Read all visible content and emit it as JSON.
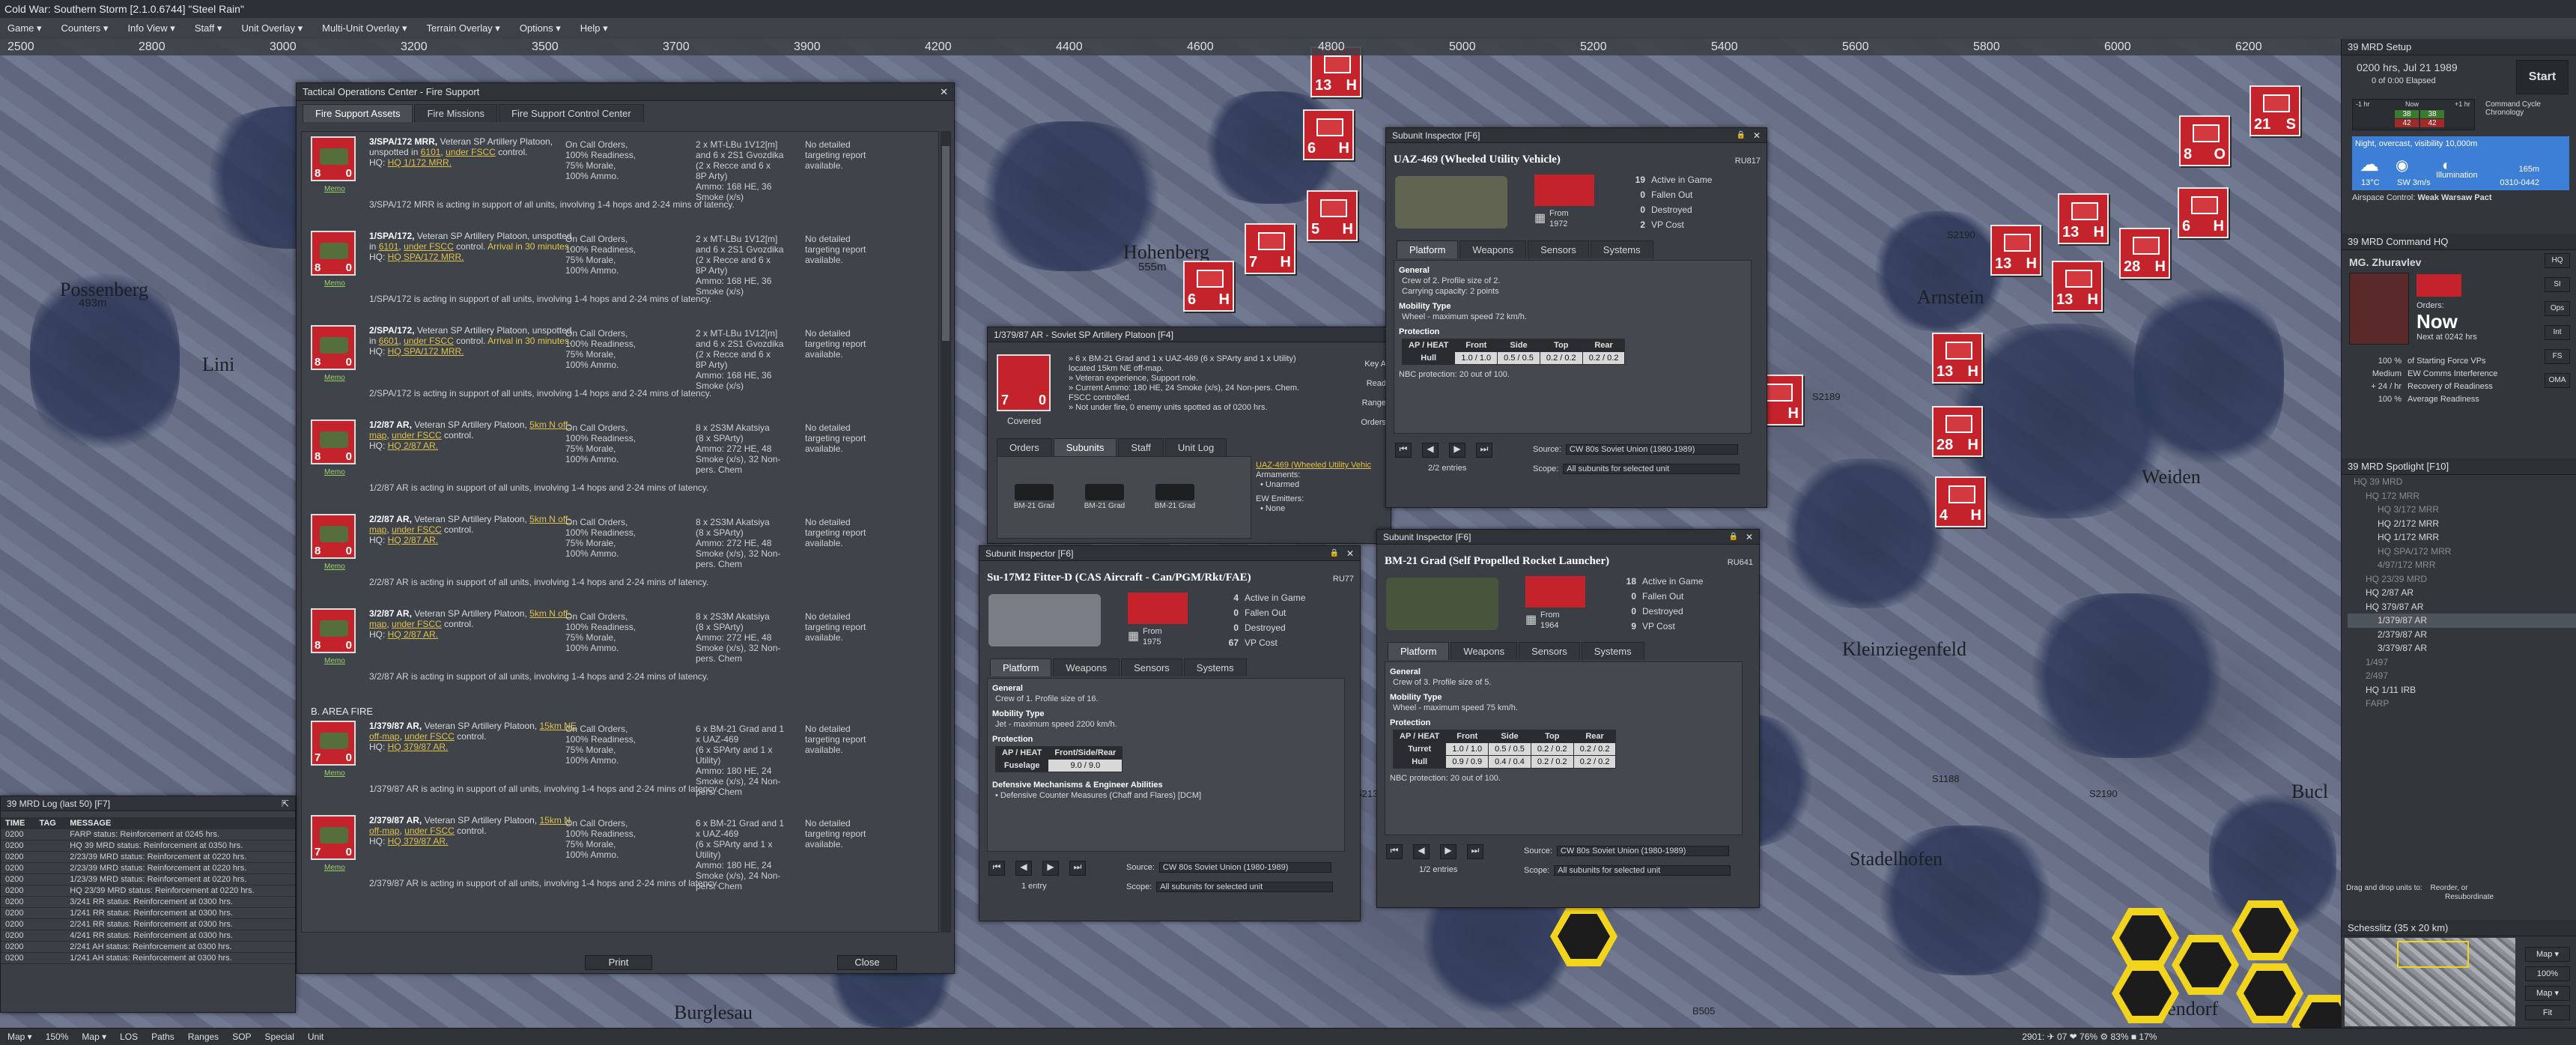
{
  "app": {
    "title": "Cold War: Southern Storm  [2.1.0.6744]  \"Steel Rain\""
  },
  "menu": [
    "Game ▾",
    "Counters ▾",
    "Info View ▾",
    "Staff ▾",
    "Unit Overlay ▾",
    "Multi-Unit Overlay ▾",
    "Terrain Overlay ▾",
    "Options ▾",
    "Help ▾"
  ],
  "ruler": [
    "2500",
    "2800",
    "3000",
    "3200",
    "3500",
    "3700",
    "3900",
    "4200",
    "4400",
    "4600",
    "4800",
    "5000",
    "5200",
    "5400",
    "5600",
    "5800",
    "6000",
    "6200"
  ],
  "map": {
    "towns": [
      "Possenberg",
      "Hohenberg",
      "Arnstein",
      "Weiden",
      "Kleinziegenfeld",
      "Stadelhofen",
      "Burglesau",
      "Wotzendorf",
      "Bucl",
      "Lini"
    ],
    "elevations": [
      "493m",
      "555m",
      "606m",
      "520m"
    ],
    "roads": [
      "S2190",
      "S2189",
      "S1188",
      "S2190",
      "B505",
      "S2136"
    ]
  },
  "fire_support": {
    "title": "Tactical Operations Center - Fire Support",
    "tabs": [
      "Fire Support Assets",
      "Fire Missions",
      "Fire Support Control Center"
    ],
    "section_b": "B. AREA FIRE",
    "print_label": "Print",
    "close_label": "Close",
    "assets": [
      {
        "name": "3/SPA/172 MRR,",
        "desc": "Veteran SP Artillery Platoon, unspotted in ",
        "hex": "6101",
        "fscc": "under FSCC",
        "extra": " control.",
        "arrival": "",
        "hq_label": "HQ: ",
        "hq": "HQ 1/172 MRR.",
        "orders": "On Call Orders,\n100% Readiness,\n75% Morale,\n100% Ammo.",
        "ammo": "2 x MT-LBu 1V12[m]\nand 6 x 2S1 Gvozdika\n(2 x Recce and 6 x\n8P Arty)\nAmmo: 168 HE, 36\nSmoke (x/s)",
        "report": "No detailed\ntargeting report\navailable.",
        "summary": "3/SPA/172 MRR is acting in support of all units, involving 1-4 hops and 2-24 mins of latency.",
        "v": "8",
        "d": "0",
        "memo": "Memo"
      },
      {
        "name": "1/SPA/172,",
        "desc": "Veteran SP Artillery Platoon, unspotted in ",
        "hex": "6101",
        "fscc": "under FSCC",
        "extra": " control. ",
        "arrival": "Arrival in 30 minutes.",
        "hq_label": "HQ: ",
        "hq": "HQ SPA/172 MRR.",
        "orders": "On Call Orders,\n100% Readiness,\n75% Morale,\n100% Ammo.",
        "ammo": "2 x MT-LBu 1V12[m]\nand 6 x 2S1 Gvozdika\n(2 x Recce and 6 x\n8P Arty)\nAmmo: 168 HE, 36\nSmoke (x/s)",
        "report": "No detailed\ntargeting report\navailable.",
        "summary": "1/SPA/172 is acting in support of all units, involving 1-4 hops and 2-24 mins of latency.",
        "v": "8",
        "d": "0",
        "memo": "Memo"
      },
      {
        "name": "2/SPA/172,",
        "desc": "Veteran SP Artillery Platoon, unspotted in ",
        "hex": "6601",
        "fscc": "under FSCC",
        "extra": " control. ",
        "arrival": "Arrival in 30 minutes.",
        "hq_label": "HQ: ",
        "hq": "HQ SPA/172 MRR.",
        "orders": "On Call Orders,\n100% Readiness,\n75% Morale,\n100% Ammo.",
        "ammo": "2 x MT-LBu 1V12[m]\nand 6 x 2S1 Gvozdika\n(2 x Recce and 6 x\n8P Arty)\nAmmo: 168 HE, 36\nSmoke (x/s)",
        "report": "No detailed\ntargeting report\navailable.",
        "summary": "2/SPA/172 is acting in support of all units, involving 1-4 hops and 2-24 mins of latency.",
        "v": "8",
        "d": "0",
        "memo": "Memo"
      },
      {
        "name": "1/2/87 AR,",
        "desc": "Veteran SP Artillery Platoon, ",
        "hex": "5km N off-map",
        "fscc": "under FSCC",
        "extra": " control.",
        "arrival": "",
        "hq_label": "HQ: ",
        "hq": "HQ 2/87 AR.",
        "orders": "On Call Orders,\n100% Readiness,\n75% Morale,\n100% Ammo.",
        "ammo": "8 x 2S3M Akatsiya\n(8 x SPArty)\nAmmo: 272 HE, 48\nSmoke (x/s), 32 Non-\npers. Chem",
        "report": "No detailed\ntargeting report\navailable.",
        "summary": "1/2/87 AR is acting in support of all units, involving 1-4 hops and 2-24 mins of latency.",
        "v": "8",
        "d": "0",
        "memo": "Memo"
      },
      {
        "name": "2/2/87 AR,",
        "desc": "Veteran SP Artillery Platoon, ",
        "hex": "5km N off-map",
        "fscc": "under FSCC",
        "extra": " control.",
        "arrival": "",
        "hq_label": "HQ: ",
        "hq": "HQ 2/87 AR.",
        "orders": "On Call Orders,\n100% Readiness,\n75% Morale,\n100% Ammo.",
        "ammo": "8 x 2S3M Akatsiya\n(8 x SPArty)\nAmmo: 272 HE, 48\nSmoke (x/s), 32 Non-\npers. Chem",
        "report": "No detailed\ntargeting report\navailable.",
        "summary": "2/2/87 AR is acting in support of all units, involving 1-4 hops and 2-24 mins of latency.",
        "v": "8",
        "d": "0",
        "memo": "Memo"
      },
      {
        "name": "3/2/87 AR,",
        "desc": "Veteran SP Artillery Platoon, ",
        "hex": "5km N off-map",
        "fscc": "under FSCC",
        "extra": " control.",
        "arrival": "",
        "hq_label": "HQ: ",
        "hq": "HQ 2/87 AR.",
        "orders": "On Call Orders,\n100% Readiness,\n75% Morale,\n100% Ammo.",
        "ammo": "8 x 2S3M Akatsiya\n(8 x SPArty)\nAmmo: 272 HE, 48\nSmoke (x/s), 32 Non-\npers. Chem",
        "report": "No detailed\ntargeting report\navailable.",
        "summary": "3/2/87 AR is acting in support of all units, involving 1-4 hops and 2-24 mins of latency.",
        "v": "8",
        "d": "0",
        "memo": "Memo"
      },
      {
        "name": "1/379/87 AR,",
        "desc": "Veteran SP Artillery Platoon, ",
        "hex": "15km NE off-map",
        "fscc": "under FSCC",
        "extra": " control.",
        "arrival": "",
        "hq_label": "HQ: ",
        "hq": "HQ 379/87 AR.",
        "orders": "On Call Orders,\n100% Readiness,\n75% Morale,\n100% Ammo.",
        "ammo": "6 x BM-21 Grad and 1\nx UAZ-469\n(6 x SPArty and 1 x\nUtility)\nAmmo: 180 HE, 24\nSmoke (x/s), 24 Non-\npers. Chem",
        "report": "No detailed\ntargeting report\navailable.",
        "summary": "1/379/87 AR is acting in support of all units, involving 1-4 hops and 2-24 mins of latency.",
        "v": "7",
        "d": "0",
        "memo": "Memo"
      },
      {
        "name": "2/379/87 AR,",
        "desc": "Veteran SP Artillery Platoon, ",
        "hex": "15km N off-map",
        "fscc": "under FSCC",
        "extra": " control.",
        "arrival": "",
        "hq_label": "HQ: ",
        "hq": "HQ 379/87 AR.",
        "orders": "On Call Orders,\n100% Readiness,\n75% Morale,\n100% Ammo.",
        "ammo": "6 x BM-21 Grad and 1\nx UAZ-469\n(6 x SPArty and 1 x\nUtility)\nAmmo: 180 HE, 24\nSmoke (x/s), 24 Non-\npers. Chem",
        "report": "No detailed\ntargeting report\navailable.",
        "summary": "2/379/87 AR is acting in support of all units, involving 1-4 hops and 2-24 mins of latency.",
        "v": "7",
        "d": "0",
        "memo": "Memo"
      }
    ]
  },
  "log": {
    "title": "39 MRD Log (last 50)  [F7]",
    "headers": [
      "TIME",
      "TAG",
      "MESSAGE"
    ],
    "rows": [
      [
        "0200",
        "",
        "FARP status: Reinforcement at 0245 hrs."
      ],
      [
        "0200",
        "",
        "HQ 39 MRD status: Reinforcement at 0350 hrs."
      ],
      [
        "0200",
        "",
        "2/23/39 MRD status: Reinforcement at 0220 hrs."
      ],
      [
        "0200",
        "",
        "2/23/39 MRD status: Reinforcement at 0220 hrs."
      ],
      [
        "0200",
        "",
        "1/23/39 MRD status: Reinforcement at 0220 hrs."
      ],
      [
        "0200",
        "",
        "HQ 23/39 MRD status: Reinforcement at 0220 hrs."
      ],
      [
        "0200",
        "",
        "3/241 RR status: Reinforcement at 0300 hrs."
      ],
      [
        "0200",
        "",
        "1/241 RR status: Reinforcement at 0300 hrs."
      ],
      [
        "0200",
        "",
        "2/241 RR status: Reinforcement at 0300 hrs."
      ],
      [
        "0200",
        "",
        "4/241 RR status: Reinforcement at 0300 hrs."
      ],
      [
        "0200",
        "",
        "2/241 AH status: Reinforcement at 0300 hrs."
      ],
      [
        "0200",
        "",
        "1/241 AH status: Reinforcement at 0300 hrs."
      ]
    ]
  },
  "unit_panel": {
    "title": "1/379/87 AR - Soviet SP Artillery Platoon   [F4]",
    "summary": "» 6 x BM-21 Grad and 1 x UAZ-469 (6 x SPArty and 1 x Utility)\nlocated 15km NE off-map.\n» Veteran experience, Support role.\n» Current Ammo: 180 HE, 24 Smoke (x/s), 24 Non-pers. Chem.\nFSCC controlled.\n» Not under fire, 0 enemy units spotted as of 0200 hrs.",
    "status": "Covered",
    "tabs": [
      "Orders",
      "Subunits",
      "Staff",
      "Unit Log"
    ],
    "subunits": [
      "BM-21 Grad",
      "BM-21 Grad",
      "BM-21 Grad"
    ],
    "side_link": "UAZ-469 (Wheeled Utility Vehic",
    "armaments_label": "Armaments:",
    "armaments": "• Unarmed",
    "ew_label": "EW Emitters:",
    "ew": "• None",
    "right_labels": [
      "Key A",
      "Read",
      "Range",
      "Orders"
    ],
    "v": "7",
    "d": "0"
  },
  "inspector_uaz": {
    "title": "Subunit Inspector   [F6]",
    "name": "UAZ-469 (Wheeled Utility Vehicle)",
    "code": "RU817",
    "from_label": "From",
    "year": "1972",
    "stats": [
      [
        "19",
        "Active in Game"
      ],
      [
        "0",
        "Fallen Out"
      ],
      [
        "0",
        "Destroyed"
      ],
      [
        "2",
        "VP Cost"
      ]
    ],
    "tabs": [
      "Platform",
      "Weapons",
      "Sensors",
      "Systems"
    ],
    "general_h": "General",
    "general": "Crew of 2. Profile size of 2.\nCarrying capacity: 2 points",
    "mobility_h": "Mobility Type",
    "mobility": "Wheel - maximum speed 72 km/h.",
    "protection_h": "Protection",
    "prot_head": [
      "AP / HEAT",
      "Front",
      "Side",
      "Top",
      "Rear"
    ],
    "prot_rows": [
      [
        "Hull",
        "1.0 / 1.0",
        "0.5 / 0.5",
        "0.2 / 0.2",
        "0.2 / 0.2"
      ]
    ],
    "nbc": "NBC protection: 20 out of 100.",
    "entries": "2/2 entries",
    "source_label": "Source:",
    "source": "CW 80s Soviet Union (1980-1989)",
    "scope_label": "Scope:",
    "scope": "All subunits for selected unit"
  },
  "inspector_su17": {
    "title": "Subunit Inspector   [F6]",
    "name": "Su-17M2 Fitter-D (CAS Aircraft - Can/PGM/Rkt/FAE)",
    "code": "RU77",
    "from_label": "From",
    "year": "1975",
    "stats": [
      [
        "4",
        "Active in Game"
      ],
      [
        "0",
        "Fallen Out"
      ],
      [
        "0",
        "Destroyed"
      ],
      [
        "67",
        "VP Cost"
      ]
    ],
    "tabs": [
      "Platform",
      "Weapons",
      "Sensors",
      "Systems"
    ],
    "general_h": "General",
    "general": "Crew of 1. Profile size of 16.",
    "mobility_h": "Mobility Type",
    "mobility": "Jet - maximum speed 2200 km/h.",
    "protection_h": "Protection",
    "prot_head": [
      "AP / HEAT",
      "Front/Side/Rear"
    ],
    "prot_rows": [
      [
        "Fuselage",
        "9.0 / 9.0"
      ]
    ],
    "defensive_h": "Defensive Mechanisms & Engineer Abilities",
    "defensive": "• Defensive Counter Measures (Chaff and Flares) [DCM]",
    "entries": "1 entry",
    "source_label": "Source:",
    "source": "CW 80s Soviet Union (1980-1989)",
    "scope_label": "Scope:",
    "scope": "All subunits for selected unit"
  },
  "inspector_bm21": {
    "title": "Subunit Inspector   [F6]",
    "name": "BM-21 Grad (Self Propelled Rocket Launcher)",
    "code": "RU641",
    "from_label": "From",
    "year": "1964",
    "stats": [
      [
        "18",
        "Active in Game"
      ],
      [
        "0",
        "Fallen Out"
      ],
      [
        "0",
        "Destroyed"
      ],
      [
        "9",
        "VP Cost"
      ]
    ],
    "tabs": [
      "Platform",
      "Weapons",
      "Sensors",
      "Systems"
    ],
    "general_h": "General",
    "general": "Crew of 3. Profile size of 5.",
    "mobility_h": "Mobility Type",
    "mobility": "Wheel - maximum speed 75 km/h.",
    "protection_h": "Protection",
    "prot_head": [
      "AP / HEAT",
      "Front",
      "Side",
      "Top",
      "Rear"
    ],
    "prot_rows": [
      [
        "Turret",
        "1.0 / 1.0",
        "0.5 / 0.5",
        "0.2 / 0.2",
        "0.2 / 0.2"
      ],
      [
        "Hull",
        "0.9 / 0.9",
        "0.4 / 0.4",
        "0.2 / 0.2",
        "0.2 / 0.2"
      ]
    ],
    "nbc": "NBC protection: 20 out of 100.",
    "entries": "1/2 entries",
    "source_label": "Source:",
    "source": "CW 80s Soviet Union (1980-1989)",
    "scope_label": "Scope:",
    "scope": "All subunits for selected unit"
  },
  "setup": {
    "title": "39 MRD Setup",
    "time": "0200 hrs, Jul 21 1989",
    "elapsed": "0 of 0:00 Elapsed",
    "start": "Start",
    "chrono_labels": [
      "-1 hr",
      "Now",
      "+1 hr"
    ],
    "chrono_values": [
      "38",
      "38",
      "42",
      "42"
    ],
    "cycle": "Command Cycle\nChronology",
    "weather": "Night, overcast, visibility 10,000m",
    "temp": "13°C",
    "wind": "SW 3m/s",
    "illumination_label": "Illumination",
    "vis": "165m",
    "moon": "0310-0442",
    "airspace_label": "Airspace Control:",
    "airspace": "Weak Warsaw Pact"
  },
  "command": {
    "title": "39 MRD Command HQ",
    "hq_label": "HQ",
    "commander": "MG. Zhuravlev",
    "orders_label": "Orders:",
    "orders": "Now",
    "next": "Next at 0242 hrs",
    "stats": [
      [
        "100 %",
        "of Starting Force VPs"
      ],
      [
        "Medium",
        "EW Comms Interference"
      ],
      [
        "+ 24 / hr",
        "Recovery of Readiness"
      ],
      [
        "100 %",
        "Average Readiness"
      ]
    ],
    "side_btns": [
      "HQ",
      "SI",
      "Ops",
      "Int",
      "FS",
      "OMA"
    ]
  },
  "spotlight": {
    "title": "39 MRD Spotlight  [F10]",
    "tree": [
      [
        "HQ 39 MRD",
        0,
        "dim"
      ],
      [
        "HQ 172 MRR",
        1,
        "dim"
      ],
      [
        "HQ 3/172 MRR",
        2,
        "dim"
      ],
      [
        "HQ 2/172 MRR",
        2,
        ""
      ],
      [
        "HQ 1/172 MRR",
        2,
        ""
      ],
      [
        "HQ SPA/172 MRR",
        2,
        "dim"
      ],
      [
        "4/97/172 MRR",
        2,
        "dim"
      ],
      [
        "HQ 23/39 MRD",
        1,
        "dim"
      ],
      [
        "HQ 2/87 AR",
        1,
        ""
      ],
      [
        "HQ 379/87 AR",
        1,
        ""
      ],
      [
        "1/379/87 AR",
        2,
        "sel"
      ],
      [
        "2/379/87 AR",
        2,
        ""
      ],
      [
        "3/379/87 AR",
        2,
        ""
      ],
      [
        "1/497",
        1,
        "dim"
      ],
      [
        "2/497",
        1,
        "dim"
      ],
      [
        "HQ 1/11 IRB",
        1,
        ""
      ],
      [
        "FARP",
        1,
        "dim"
      ]
    ],
    "drag_hint": "Drag and drop units to:",
    "reorder": "Reorder, or",
    "resubordinate": "Resubordinate"
  },
  "minimap": {
    "title": "Schesslitz (35 x 20 km)",
    "btns": [
      "Map ▾",
      "100%",
      "Map ▾",
      "Fit"
    ]
  },
  "statusbar": {
    "items": [
      "Map ▾",
      "150%",
      "Map ▾",
      "LOS",
      "Paths",
      "Ranges",
      "SOP",
      "Special",
      "Unit"
    ],
    "right": "2901:   ✈ 07   ❤ 76%   ⚙ 83%   ■ 17%"
  },
  "colors": {
    "soviet_red": "#c5232b",
    "highlight": "#f2d41c"
  }
}
